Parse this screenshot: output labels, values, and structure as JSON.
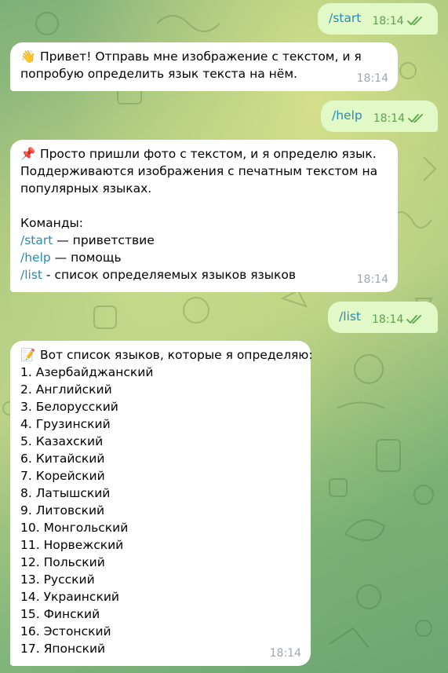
{
  "messages": {
    "start": {
      "text": "/start",
      "time": "18:14"
    },
    "greeting": {
      "emoji": "👋",
      "text": "Привет! Отправь мне изображение с текстом, и я попробую определить язык текста на нём.",
      "line1": "Привет! Отправь мне изображение с текстом, и я",
      "line2": "попробую определить язык текста на нём.",
      "time": "18:14"
    },
    "help": {
      "text": "/help",
      "time": "18:14"
    },
    "help_reply": {
      "emoji": "📌",
      "line1": "Просто пришли фото с текстом, и я определю язык.",
      "line2": "Поддерживаются изображения с печатным текстом на",
      "line3": "популярных языках.",
      "commands_title": "Команды:",
      "cmd_start": "/start",
      "cmd_start_desc": " — приветствие",
      "cmd_help": "/help",
      "cmd_help_desc": " — помощь",
      "cmd_list": "/list",
      "cmd_list_desc": " - список определяемых языков языков",
      "time": "18:14"
    },
    "list": {
      "text": "/list",
      "time": "18:14"
    },
    "list_reply": {
      "emoji": "📝",
      "header": "Вот список языков, которые я определяю:",
      "items": [
        "1. Азербайджанский",
        "2. Английский",
        "3. Белорусский",
        "4. Грузинский",
        "5. Казахский",
        "6. Китайский",
        "7. Корейский",
        "8. Латышский",
        "9. Литовский",
        "10. Монгольский",
        "11. Норвежский",
        "12. Польский",
        "13. Русский",
        "14. Украинский",
        "15. Финский",
        "16. Эстонский",
        "17. Японский"
      ],
      "time": "18:14"
    }
  },
  "colors": {
    "outgoing_bubble": "#e1f8c7",
    "incoming_bubble": "#ffffff",
    "link": "#2a8ab6",
    "read_checks": "#5aa64b",
    "time_incoming": "#a0a7ac"
  },
  "icons": {
    "read_status": "double-check-icon"
  }
}
